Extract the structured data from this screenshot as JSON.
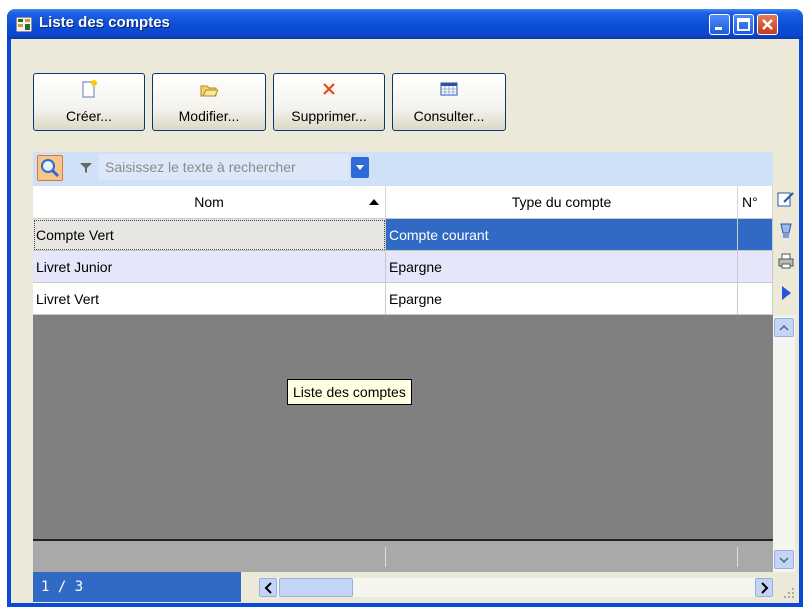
{
  "window": {
    "title": "Liste des comptes"
  },
  "toolbar": {
    "create_label": "Créer...",
    "modify_label": "Modifier...",
    "delete_label": "Supprimer...",
    "view_label": "Consulter..."
  },
  "search": {
    "placeholder": "Saisissez le texte à rechercher"
  },
  "table": {
    "headers": [
      "Nom",
      "Type du compte",
      "N°"
    ],
    "rows": [
      [
        "Compte Vert",
        "Compte courant",
        ""
      ],
      [
        "Livret Junior",
        "Epargne",
        ""
      ],
      [
        "Livret Vert",
        "Epargne",
        ""
      ]
    ],
    "sort_column": "Nom",
    "sort_direction": "ascending"
  },
  "status": {
    "record_counter": "1 / 3"
  },
  "tooltip": {
    "text": "Liste des comptes"
  },
  "colors": {
    "title_bar": "#0a4ad8",
    "selection": "#316ac5",
    "alt_row": "#e6e6fa",
    "tooltip_bg": "#ffffe1"
  },
  "icons": [
    "app-icon",
    "new-document-icon",
    "folder-open-icon",
    "delete-x-icon",
    "calendar-icon",
    "search-icon",
    "filter-icon",
    "dropdown-arrow-icon",
    "edit-icon",
    "cup-icon",
    "printer-icon",
    "play-icon"
  ]
}
